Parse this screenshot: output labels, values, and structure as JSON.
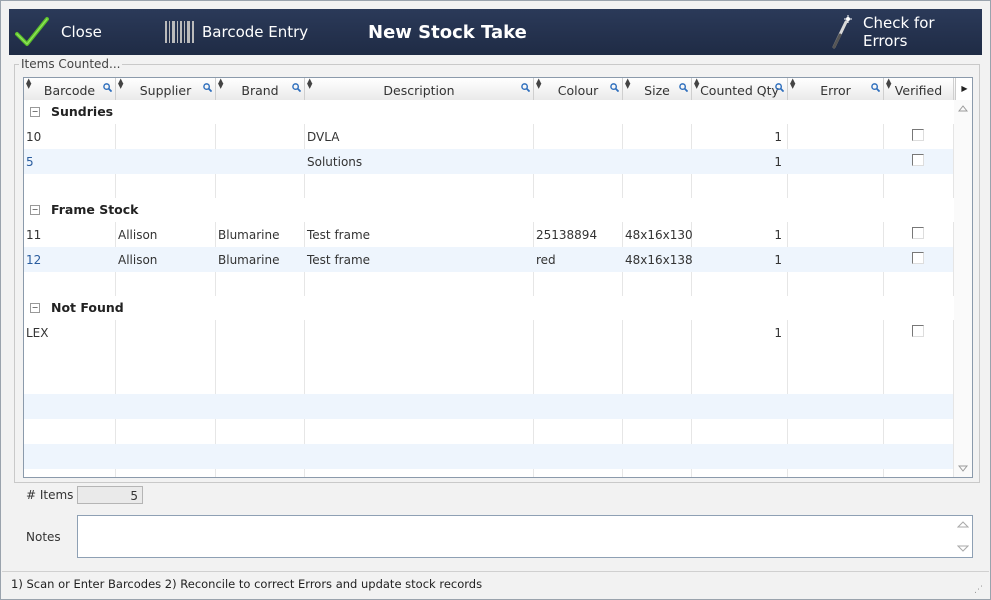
{
  "toolbar": {
    "close_label": "Close",
    "barcode_label": "Barcode Entry",
    "title": "New Stock Take",
    "check_label": "Check for Errors"
  },
  "group_title": "Items Counted...",
  "columns": [
    {
      "key": "barcode",
      "label": "Barcode"
    },
    {
      "key": "supplier",
      "label": "Supplier"
    },
    {
      "key": "brand",
      "label": "Brand"
    },
    {
      "key": "description",
      "label": "Description"
    },
    {
      "key": "colour",
      "label": "Colour"
    },
    {
      "key": "size",
      "label": "Size"
    },
    {
      "key": "qty",
      "label": "Counted Qty"
    },
    {
      "key": "error",
      "label": "Error"
    },
    {
      "key": "verified",
      "label": "Verified"
    }
  ],
  "groups": [
    {
      "name": "Sundries",
      "rows": [
        {
          "barcode": "10",
          "supplier": "",
          "brand": "",
          "description": "DVLA",
          "colour": "",
          "size": "",
          "qty": "1",
          "error": "",
          "verified": false
        },
        {
          "barcode": "5",
          "supplier": "",
          "brand": "",
          "description": "Solutions",
          "colour": "",
          "size": "",
          "qty": "1",
          "error": "",
          "verified": false
        }
      ]
    },
    {
      "name": "Frame Stock",
      "rows": [
        {
          "barcode": "11",
          "supplier": "Allison",
          "brand": "Blumarine",
          "description": "Test frame",
          "colour": "25138894",
          "size": "48x16x130",
          "qty": "1",
          "error": "",
          "verified": false
        },
        {
          "barcode": "12",
          "supplier": "Allison",
          "brand": "Blumarine",
          "description": "Test frame",
          "colour": "red",
          "size": "48x16x138",
          "qty": "1",
          "error": "",
          "verified": false
        }
      ]
    },
    {
      "name": "Not Found",
      "rows": [
        {
          "barcode": "LEX",
          "supplier": "",
          "brand": "",
          "description": "",
          "colour": "",
          "size": "",
          "qty": "1",
          "error": "",
          "verified": false
        }
      ]
    }
  ],
  "items_label": "# Items",
  "items_count": "5",
  "notes_label": "Notes",
  "notes_value": "",
  "status_text": "1) Scan or Enter Barcodes  2) Reconcile to correct Errors and update stock records",
  "icons": {
    "close": "checkmark-icon",
    "barcode": "barcode-icon",
    "check": "magic-wand-icon",
    "search": "search-icon"
  },
  "colors": {
    "toolbar_bg": "#1f2b45",
    "close_check": "#5cc02a",
    "alt_row": "#eef5fd",
    "search_icon": "#2f6fbd"
  }
}
